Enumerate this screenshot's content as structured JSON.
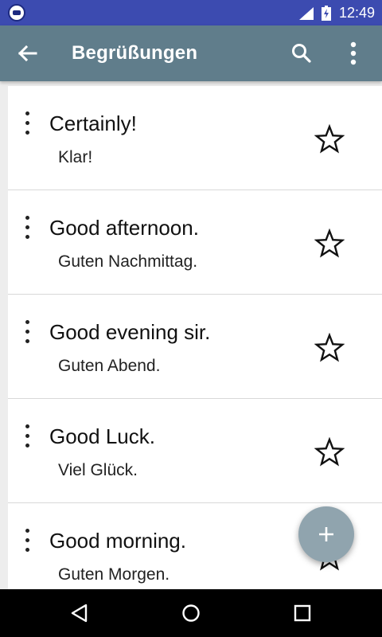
{
  "status_bar": {
    "time": "12:49",
    "icons": [
      "app-icon",
      "signal-icon",
      "battery-icon"
    ]
  },
  "toolbar": {
    "title": "Begrüßungen",
    "icons": [
      "back-arrow-icon",
      "search-icon",
      "overflow-menu-icon"
    ]
  },
  "phrases": [
    {
      "english": "Certainly!",
      "german": "Klar!"
    },
    {
      "english": "Good afternoon.",
      "german": "Guten Nachmittag."
    },
    {
      "english": "Good evening sir.",
      "german": "Guten Abend."
    },
    {
      "english": "Good Luck.",
      "german": "Viel Glück."
    },
    {
      "english": "Good morning.",
      "german": "Guten Morgen."
    }
  ],
  "fab": {
    "icon": "plus-icon"
  },
  "nav_bar": {
    "icons": [
      "back-triangle-icon",
      "home-circle-icon",
      "recents-square-icon"
    ]
  },
  "colors": {
    "status_bar": "#3c4bb0",
    "toolbar": "#607d8b",
    "fab": "#90a4ae"
  }
}
